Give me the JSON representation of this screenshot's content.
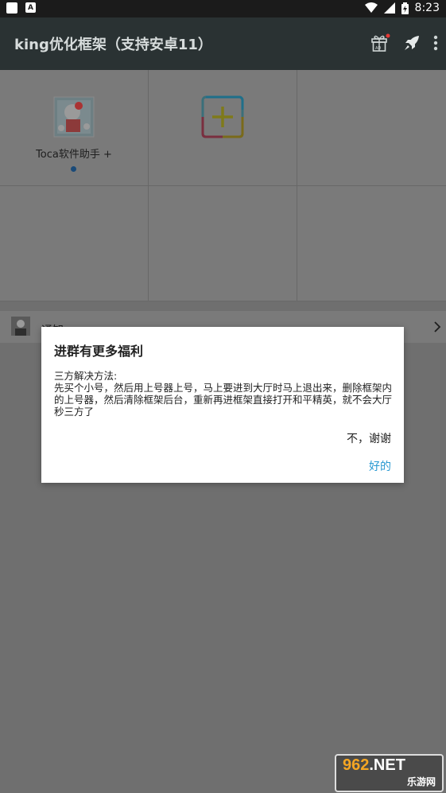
{
  "status_bar": {
    "time": "8:23"
  },
  "app_bar": {
    "title": "king优化框架（支持安卓11）"
  },
  "apps": [
    {
      "label": "Toca软件助手 +",
      "icon": "toca-hello-kitty-icon"
    },
    {
      "label": "",
      "icon": "add-app-icon"
    }
  ],
  "notice": {
    "label": "通知"
  },
  "dialog": {
    "title": "进群有更多福利",
    "body": "三方解决方法:\n先买个小号，然后用上号器上号，马上要进到大厅时马上退出来，删除框架内的上号器，然后清除框架后台，重新再进框架直接打开和平精英，就不会大厅秒三方了",
    "negative": "不，谢谢",
    "positive": "好的"
  },
  "watermark": {
    "top_a": "962",
    "top_b": ".NET",
    "bottom": "乐游网"
  },
  "colors": {
    "appbar": "#2a3233",
    "accent": "#2a9ad2"
  }
}
